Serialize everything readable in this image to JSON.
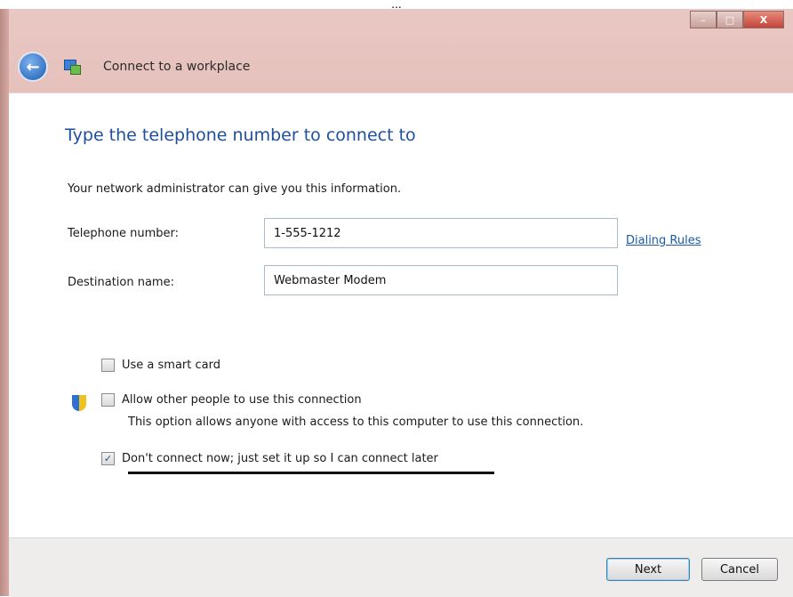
{
  "screen_caption": "...",
  "window": {
    "title": "Connect to a workplace",
    "minimize_symbol": "–",
    "maximize_symbol": "□",
    "close_symbol": "X"
  },
  "nav": {
    "back_icon": "back-arrow-icon"
  },
  "page": {
    "heading": "Type the telephone number to connect to",
    "info": "Your network administrator can give you this information."
  },
  "fields": {
    "telephone_label": "Telephone number:",
    "telephone_value": "1-555-1212",
    "destination_label": "Destination name:",
    "destination_value": "Webmaster Modem"
  },
  "dialing_rules_link": "Dialing Rules",
  "options": {
    "smart_card": {
      "label": "Use a smart card",
      "checked": false
    },
    "allow_others": {
      "label": "Allow other people to use this connection",
      "checked": false,
      "description": "This option allows anyone with access to this computer to use this connection."
    },
    "dont_connect": {
      "label": "Don't connect now; just set it up so I can connect later",
      "checked": true,
      "check_mark": "✓"
    }
  },
  "buttons": {
    "next": "Next",
    "cancel": "Cancel"
  },
  "colors": {
    "heading": "#1e4f9c",
    "link": "#1a5aa8",
    "frame": "#e2b6b0"
  }
}
